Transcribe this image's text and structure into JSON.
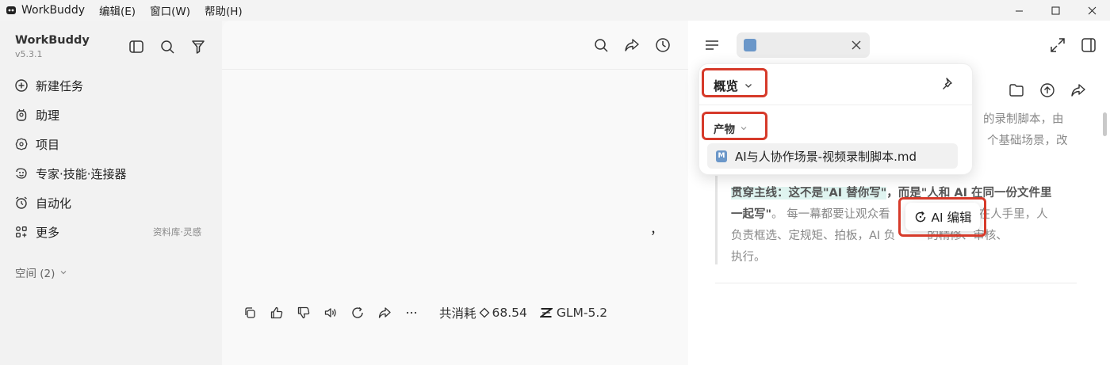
{
  "titlebar": {
    "app_name": "WorkBuddy",
    "menus": [
      "编辑(E)",
      "窗口(W)",
      "帮助(H)"
    ]
  },
  "sidebar": {
    "brand": "WorkBuddy",
    "version": "v5.3.1",
    "items": [
      {
        "label": "新建任务",
        "icon": "plus-circle-icon"
      },
      {
        "label": "助理",
        "icon": "assistant-icon"
      },
      {
        "label": "项目",
        "icon": "project-icon"
      },
      {
        "label": "专家·技能·连接器",
        "icon": "expert-icon"
      },
      {
        "label": "自动化",
        "icon": "alarm-icon"
      },
      {
        "label": "更多",
        "icon": "grid-icon",
        "extra": "资料库·灵感"
      }
    ],
    "space_label": "空间 (2)"
  },
  "main": {
    "comma": "，",
    "cost_label": "共消耗",
    "cost_value": "68.54",
    "model": "GLM-5.2"
  },
  "panel": {
    "doc_lines": {
      "line1": "的录制脚本，由",
      "line2": "个基础场景，改",
      "quote_hl": "贯穿主线：这不是\"AI 替你写\"",
      "quote_bold1": "，而是\"人和 AI 在同一份文件里",
      "quote_bold2": "一起写\"",
      "quote_rest1": "。 每一幕都要让观众看",
      "quote_rest1b": "在人手里，人",
      "quote_rest2": "负责框选、定规矩、拍板，AI 负",
      "quote_rest2b": "的精修、审核、",
      "quote_rest3": "执行。"
    },
    "popup": {
      "overview": "概览",
      "products": "产物",
      "file": "AI与人协作场景-视频录制脚本.md",
      "file_badge": "M"
    },
    "ai_edit": "AI 编辑"
  },
  "colors": {
    "highlight_box": "#d63a2a",
    "file_icon": "#6b97c9",
    "quote_highlight": "#dff4f0"
  }
}
